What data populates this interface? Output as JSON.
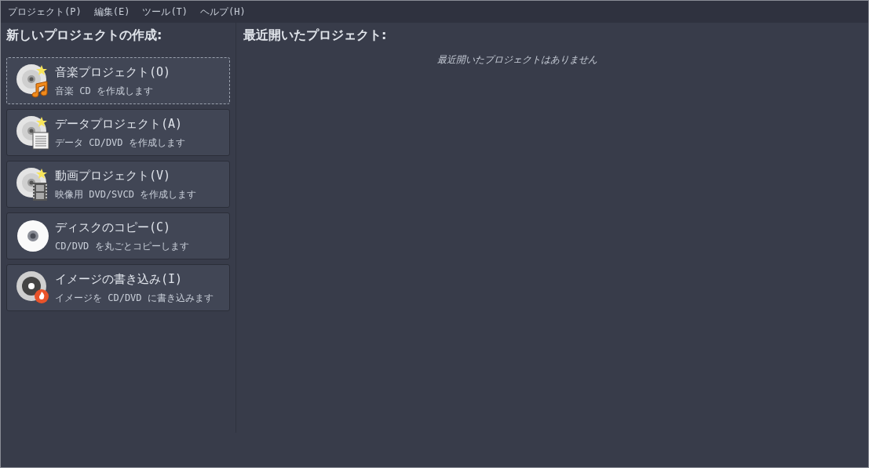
{
  "menu": [
    "プロジェクト(P)",
    "編集(E)",
    "ツール(T)",
    "ヘルプ(H)"
  ],
  "new_project": {
    "title": "新しいプロジェクトの作成:",
    "items": [
      {
        "kind": "audio",
        "label": "音楽プロジェクト(O)",
        "description": "音楽 CD を作成します",
        "focused": true
      },
      {
        "kind": "data",
        "label": "データプロジェクト(A)",
        "description": "データ CD/DVD を作成します",
        "focused": false
      },
      {
        "kind": "video",
        "label": "動画プロジェクト(V)",
        "description": "映像用 DVD/SVCD を作成します",
        "focused": false
      },
      {
        "kind": "copy",
        "label": "ディスクのコピー(C)",
        "description": "CD/DVD を丸ごとコピーします",
        "focused": false
      },
      {
        "kind": "burn",
        "label": "イメージの書き込み(I)",
        "description": "イメージを CD/DVD に書き込みます",
        "focused": false
      }
    ]
  },
  "recent": {
    "title": "最近開いたプロジェクト:",
    "empty_message": "最近開いたプロジェクトはありません"
  }
}
